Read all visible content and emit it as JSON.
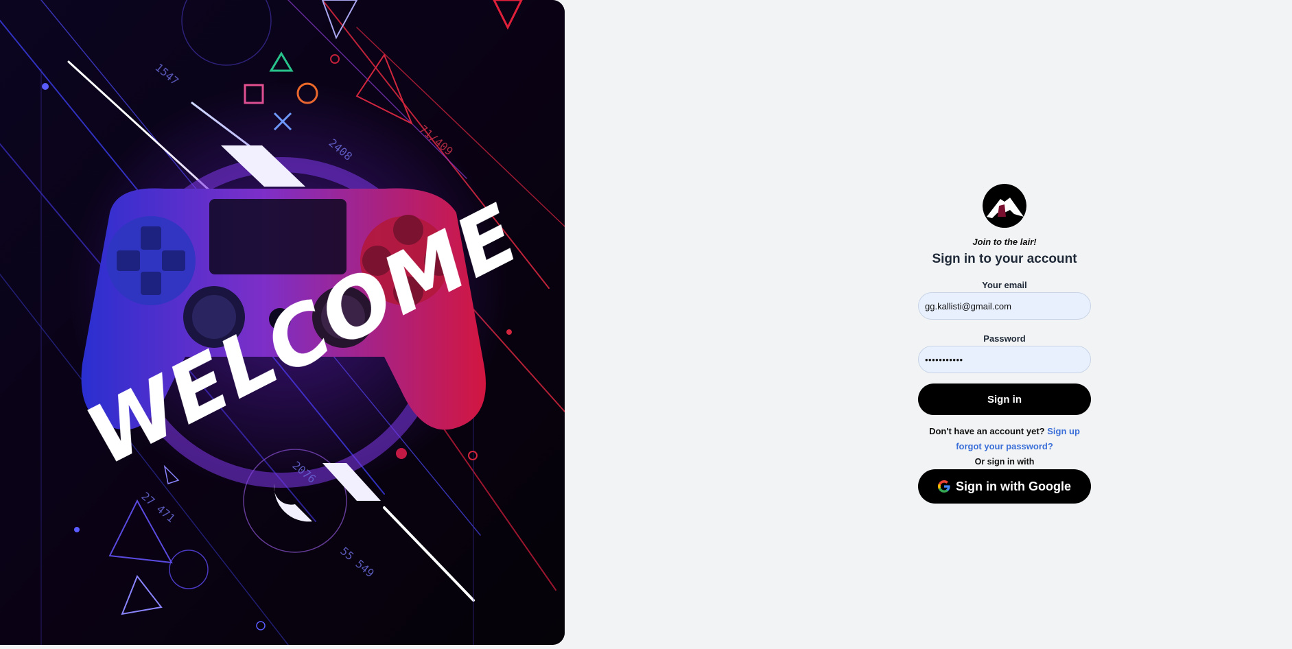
{
  "hero": {
    "welcome_text": "WELCOME",
    "decor_numbers": [
      "1547",
      "2408",
      "71/409",
      "2076",
      "27 471",
      "55 549"
    ]
  },
  "logo": {
    "icon": "lair-mountain-logo"
  },
  "form": {
    "tagline": "Join to the lair!",
    "title": "Sign in to your account",
    "email_label": "Your email",
    "email_value": "gg.kallisti@gmail.com",
    "password_label": "Password",
    "password_value": "•••••••••••",
    "submit_label": "Sign in",
    "no_account_text": "Don't have an account yet?",
    "signup_link": "Sign up",
    "forgot_link": "forgot your password?",
    "or_text": "Or sign in with",
    "google_label": "Sign in with Google",
    "google_icon": "google-g-icon"
  },
  "colors": {
    "page_bg": "#f2f3f5",
    "button_bg": "#000000",
    "input_bg": "#e8f0fe",
    "link": "#3b6fd8"
  }
}
